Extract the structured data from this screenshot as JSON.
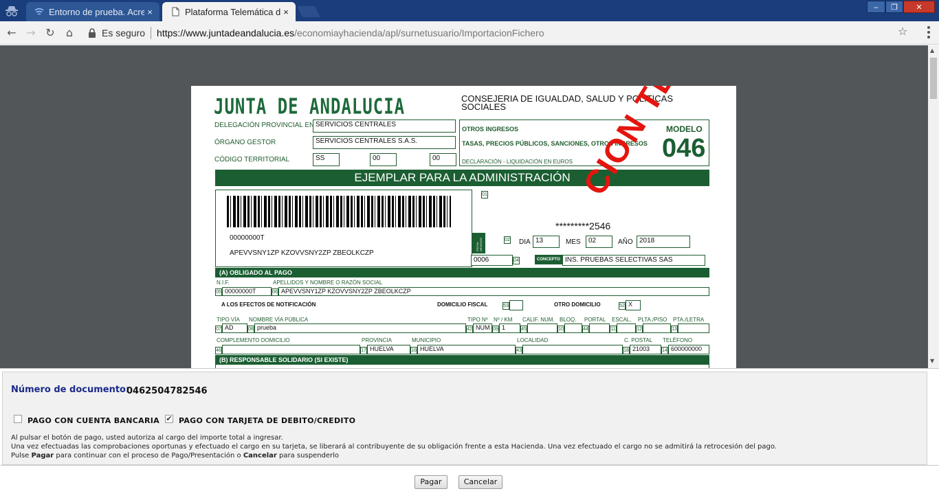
{
  "browser": {
    "tabs": [
      {
        "title": "Entorno de prueba. Acre",
        "close": "×"
      },
      {
        "title": "Plataforma Telemática de",
        "close": "×"
      }
    ],
    "window_controls": {
      "minimize": "‒",
      "maximize": "❐",
      "close": "✕"
    },
    "secure_label": "Es seguro",
    "url_host": "https://www.juntadeandalucia.es",
    "url_path": "/economiayhacienda/apl/surnetusuario/ImportacionFichero",
    "accent": "#1a3e7b"
  },
  "form": {
    "logo": "JUNTA DE ANDALUCIA",
    "consejeria": "CONSEJERIA DE IGUALDAD, SALUD Y POLITICAS SOCIALES",
    "delegacion_label": "DELEGACIÓN PROVINCIAL EN",
    "delegacion_value": "SERVICIOS CENTRALES",
    "organo_label": "ÓRGANO GESTOR",
    "organo_value": "SERVICIOS CENTRALES S.A.S.",
    "codigo_label": "CÓDIGO TERRITORIAL",
    "codigo_values": [
      "SS",
      "00",
      "00"
    ],
    "otros_ingresos": "OTROS INGRESOS",
    "tasas": "TASAS, PRECIOS PÚBLICOS, SANCIONES, OTROS INGRESOS",
    "declaracion": "DECLARACIÓN - LIQUIDACIÓN EN EUROS",
    "modelo_label": "MODELO",
    "modelo_number": "046",
    "ejemplar": "EJEMPLAR PARA LA ADMINISTRACIÓN",
    "barcode_nif": "00000000T",
    "barcode_name": "APEVVSNY1ZP KZOVVSNY2ZP ZBEOLKCZP",
    "field01": "01",
    "masked_number": "*********2546",
    "fecha_label": "FECHA DEVENGO",
    "field02": "02",
    "dia_label": "DIA",
    "dia_value": "13",
    "mes_label": "MES",
    "mes_value": "02",
    "anio_label": "AÑO",
    "anio_value": "2018",
    "code_value": "0006",
    "field04": "04",
    "concepto_label": "CONCEPTO",
    "concepto_value": "INS. PRUEBAS SELECTIVAS SAS",
    "section_a": "(A) OBLIGADO AL PAGO",
    "nif_label": "N.I.F.",
    "apellidos_label": "APELLIDOS Y NOMBRE O RAZÓN SOCIAL",
    "field05": "05",
    "nif_value": "00000000T",
    "field06": "06",
    "nombre_value": "APEVVSNY1ZP KZOVVSNY2ZP ZBEOLKCZP",
    "notificacion_label": "A LOS EFECTOS DE NOTIFICACIÓN",
    "domicilio_fiscal_label": "DOMICILIO FISCAL",
    "field53": "53",
    "otro_domicilio_label": "OTRO DOMICILIO",
    "field52": "52",
    "otro_domicilio_value": "X",
    "tipo_via_label": "TIPO VÍA",
    "nombre_via_label": "NOMBRE VÍA PÚBLICA",
    "tipo_num_label": "TIPO Nº",
    "num_km_label": "Nº / KM",
    "calif_label": "CALIF. NUM.",
    "bloq_label": "BLOQ.",
    "portal_label": "PORTAL",
    "escal_label": "ESCAL.",
    "planta_label": "PLTA./PISO",
    "puerta_label": "PTA./LETRA",
    "field07": "07",
    "tipo_via_value": "AD",
    "field08": "08",
    "via_value": "prueba",
    "field42": "42",
    "tipo_num_value": "NUM",
    "field09": "09",
    "num_value": "1",
    "field45": "45",
    "field10": "10",
    "field44": "44",
    "field11": "11",
    "field12": "12",
    "field13": "13",
    "complemento_label": "COMPLEMENTO DOMICILIO",
    "provincia_label": "PROVINCIA",
    "municipio_label": "MUNICIPIO",
    "localidad_label": "LOCALIDAD",
    "cpostal_label": "C. POSTAL",
    "telefono_label": "TELÉFONO",
    "field46": "46",
    "field17": "17",
    "provincia_value": "HUELVA",
    "field16": "16",
    "municipio_value": "HUELVA",
    "field43": "43",
    "field18": "18",
    "cpostal_value": "21003",
    "field14": "14",
    "telefono_value": "600000000",
    "section_b": "(B) RESPONSABLE SOLIDARIO (SI EXISTE)",
    "stamp": "CION TELÉM"
  },
  "payment": {
    "doc_label": "Número de documento:",
    "doc_number": "0462504782546",
    "opt_bank": "PAGO CON CUENTA BANCARIA",
    "opt_bank_checked": false,
    "opt_card": "PAGO CON TARJETA DE DEBITO/CREDITO",
    "opt_card_checked": true,
    "check_mark": "✔",
    "line1": "Al pulsar el botón de pago, usted autoriza al cargo del importe total a ingresar.",
    "line2": "Una vez efectuadas las comprobaciones oportunas y efectuado el cargo en su tarjeta, se liberará al contribuyente de su obligación frente a esta Hacienda. Una vez efectuado el cargo no se admitirá la retrocesión del pago.",
    "line3_a": "Pulse ",
    "line3_pagar": "Pagar",
    "line3_b": " para continuar con el proceso de Pago/Presentación o ",
    "line3_cancelar": "Cancelar",
    "line3_c": " para suspenderlo",
    "btn_pagar": "Pagar",
    "btn_cancelar": "Cancelar"
  }
}
